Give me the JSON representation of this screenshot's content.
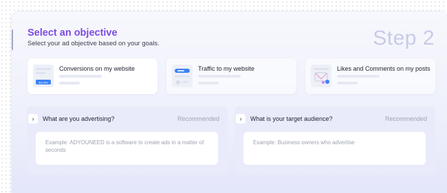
{
  "header": {
    "title": "Select an objective",
    "subtitle": "Select your ad objective based on your goals.",
    "step": "Step 2"
  },
  "options": [
    {
      "label": "Conversions on my website",
      "thumb_button": "Buy Now",
      "icon": "shopping-page-icon"
    },
    {
      "label": "Traffic to my website",
      "icon": "browser-traffic-icon"
    },
    {
      "label": "Likes and Comments on my posts",
      "icon": "social-post-icon"
    }
  ],
  "panels": [
    {
      "label": "What are you advertising?",
      "badge": "Recommended",
      "placeholder": "Example: ADYOUNEED is a software to create ads in a matter of seconds"
    },
    {
      "label": "What is your target audience?",
      "badge": "Recommended",
      "placeholder": "Example: Business owners who advertise"
    }
  ],
  "colors": {
    "accent": "#7c4ce0",
    "step": "#c8cbe6",
    "link_blue": "#3b82f6"
  }
}
